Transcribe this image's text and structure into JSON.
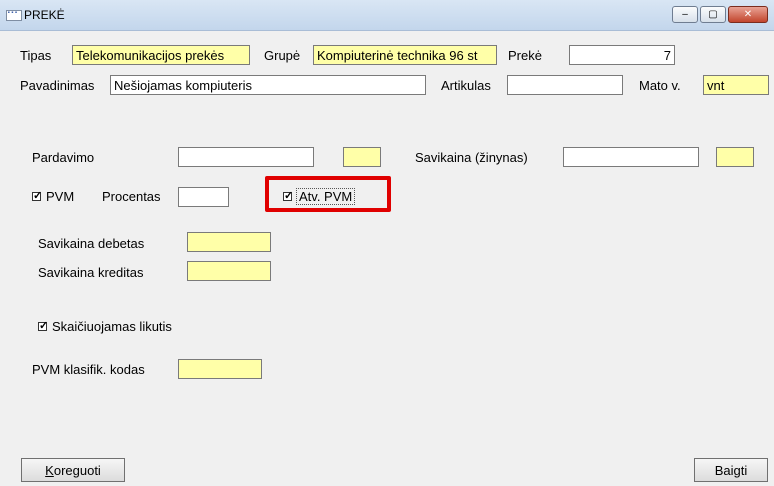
{
  "window": {
    "title": "PREKĖ",
    "app_icon": "app-icon",
    "controls": {
      "minimize": "–",
      "maximize": "▢",
      "close": "✕"
    }
  },
  "row1": {
    "tipas_label": "Tipas",
    "tipas_value": "Telekomunikacijos prekės",
    "grupe_label": "Grupė",
    "grupe_value": "Kompiuterinė technika 96 st",
    "preke_label": "Prekė",
    "preke_value": "7"
  },
  "row2": {
    "pavadinimas_label": "Pavadinimas",
    "pavadinimas_value": "Nešiojamas kompiuteris",
    "artikulas_label": "Artikulas",
    "artikulas_value": "",
    "mato_label": "Mato v.",
    "mato_value": "vnt"
  },
  "pardavimo": {
    "label": "Pardavimo",
    "value": "",
    "small_value": ""
  },
  "savikaina_zinynas": {
    "label": "Savikaina (žinynas)",
    "value": "",
    "small_value": ""
  },
  "pvm": {
    "checkbox_label": "PVM",
    "checked": true,
    "procentas_label": "Procentas",
    "procentas_value": "",
    "atv_pvm_label": "Atv. PVM",
    "atv_pvm_checked": true
  },
  "savikaina_debetas": {
    "label": "Savikaina debetas",
    "value": ""
  },
  "savikaina_kreditas": {
    "label": "Savikaina kreditas",
    "value": ""
  },
  "skaiciuojamas": {
    "label": "Skaičiuojamas likutis",
    "checked": true
  },
  "pvm_klasifik": {
    "label": "PVM klasifik. kodas",
    "value": ""
  },
  "buttons": {
    "koreguoti": "Koreguoti",
    "baigti": "Baigti"
  },
  "colors": {
    "required_field": "#ffffa8",
    "highlight": "#e00000"
  }
}
